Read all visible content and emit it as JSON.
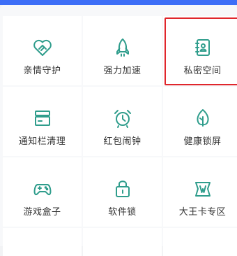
{
  "colors": {
    "accent": "#3d6ef7",
    "icon": "#2f9d8c",
    "highlight_border": "#e0262c"
  },
  "tiles": [
    {
      "label": "亲情守护",
      "icon": "heart-handshake-icon"
    },
    {
      "label": "强力加速",
      "icon": "rocket-icon"
    },
    {
      "label": "私密空间",
      "icon": "contacts-book-icon",
      "highlighted": true
    },
    {
      "label": "通知栏清理",
      "icon": "notification-bar-icon"
    },
    {
      "label": "红包闹钟",
      "icon": "alarm-clock-icon"
    },
    {
      "label": "健康锁屏",
      "icon": "leaf-icon"
    },
    {
      "label": "游戏盒子",
      "icon": "gamepad-icon"
    },
    {
      "label": "软件锁",
      "icon": "lock-bag-icon"
    },
    {
      "label": "大王卡专区",
      "icon": "wang-card-icon"
    }
  ]
}
